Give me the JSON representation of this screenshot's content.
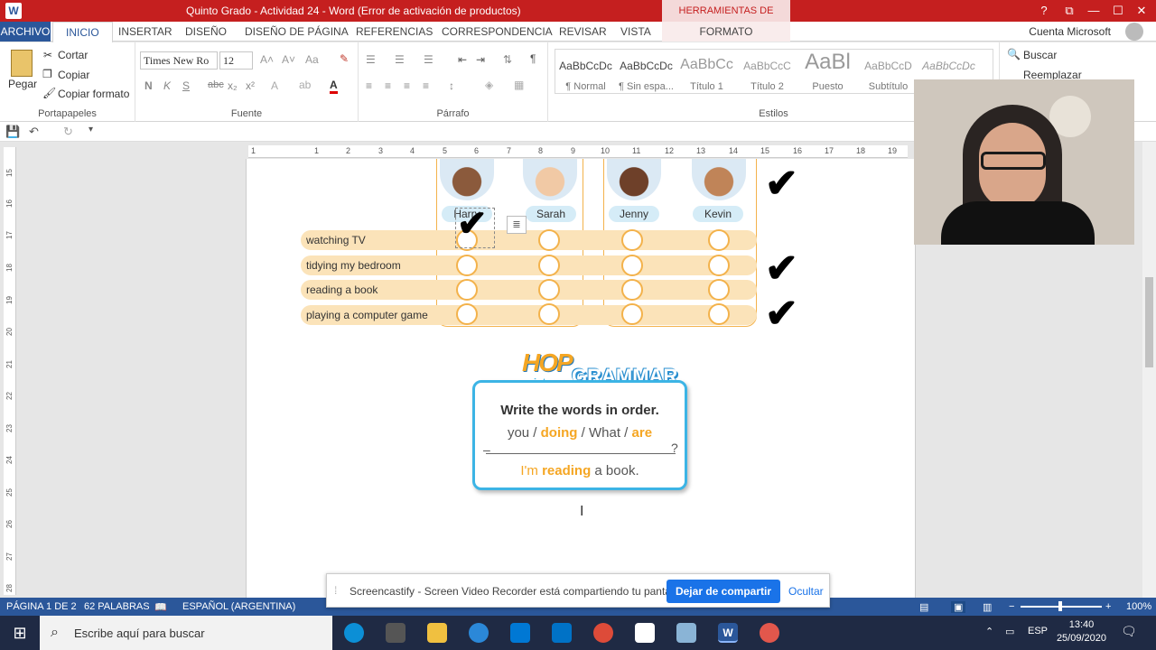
{
  "window": {
    "title": "Quinto Grado - Actividad 24 -  Word (Error de activación de productos)",
    "context_tab_group": "HERRAMIENTAS DE IMAGEN",
    "controls": [
      "?",
      "⧉",
      "—",
      "☐",
      "✕"
    ]
  },
  "tabs": {
    "file": "ARCHIVO",
    "items": [
      "INICIO",
      "INSERTAR",
      "DISEÑO",
      "DISEÑO DE PÁGINA",
      "REFERENCIAS",
      "CORRESPONDENCIA",
      "REVISAR",
      "VISTA"
    ],
    "context": "FORMATO",
    "account": "Cuenta Microsoft"
  },
  "ribbon": {
    "clipboard": {
      "paste": "Pegar",
      "cut": "Cortar",
      "copy": "Copiar",
      "format_painter": "Copiar formato",
      "label": "Portapapeles"
    },
    "font": {
      "name": "Times New Ro",
      "size": "12",
      "label": "Fuente"
    },
    "paragraph": {
      "label": "Párrafo"
    },
    "styles": {
      "label": "Estilos",
      "items": [
        {
          "sample": "AaBbCcDc",
          "name": "¶ Normal"
        },
        {
          "sample": "AaBbCcDc",
          "name": "¶ Sin espa..."
        },
        {
          "sample": "AaBbCc",
          "name": "Título 1"
        },
        {
          "sample": "AaBbCcC",
          "name": "Título 2"
        },
        {
          "sample": "AaBl",
          "name": "Puesto"
        },
        {
          "sample": "AaBbCcD",
          "name": "Subtítulo"
        },
        {
          "sample": "AaBbCcDc",
          "name": ""
        }
      ]
    },
    "editing": {
      "find": "Buscar",
      "replace": "Reemplazar"
    }
  },
  "rulers": {
    "horizontal": [
      "1",
      "1",
      "2",
      "3",
      "4",
      "5",
      "6",
      "7",
      "8",
      "9",
      "10",
      "11",
      "12",
      "13",
      "14",
      "15",
      "16",
      "17",
      "18",
      "19"
    ],
    "vertical": [
      "15",
      "16",
      "17",
      "18",
      "19",
      "20",
      "21",
      "22",
      "23",
      "24",
      "25",
      "26",
      "27",
      "28"
    ]
  },
  "document": {
    "kids": [
      "Harry",
      "Sarah",
      "Jenny",
      "Kevin"
    ],
    "activities": [
      "watching TV",
      "tidying my bedroom",
      "reading a book",
      "playing a computer game"
    ],
    "grammar": {
      "hop": "HOP",
      "into": "into",
      "heading": "GRAMMAR",
      "instruction": "Write the words in order.",
      "w1": "you",
      "w2": "doing",
      "w3": "What",
      "w4": "are",
      "sep": "/",
      "qmark": "?",
      "dash": "–",
      "a1": "I'm",
      "a2": "reading",
      "a3": "a book."
    },
    "check_glyph": "✔"
  },
  "status": {
    "page": "PÁGINA 1 DE 2",
    "words": "62 PALABRAS",
    "lang": "ESPAÑOL (ARGENTINA)",
    "zoom": "100%"
  },
  "share_bar": {
    "message": "Screencastify - Screen Video Recorder está compartiendo tu pantalla.",
    "stop": "Dejar de compartir",
    "hide": "Ocultar"
  },
  "taskbar": {
    "search_placeholder": "Escribe aquí para buscar",
    "lang": "ESP",
    "time": "13:40",
    "date": "25/09/2020"
  }
}
